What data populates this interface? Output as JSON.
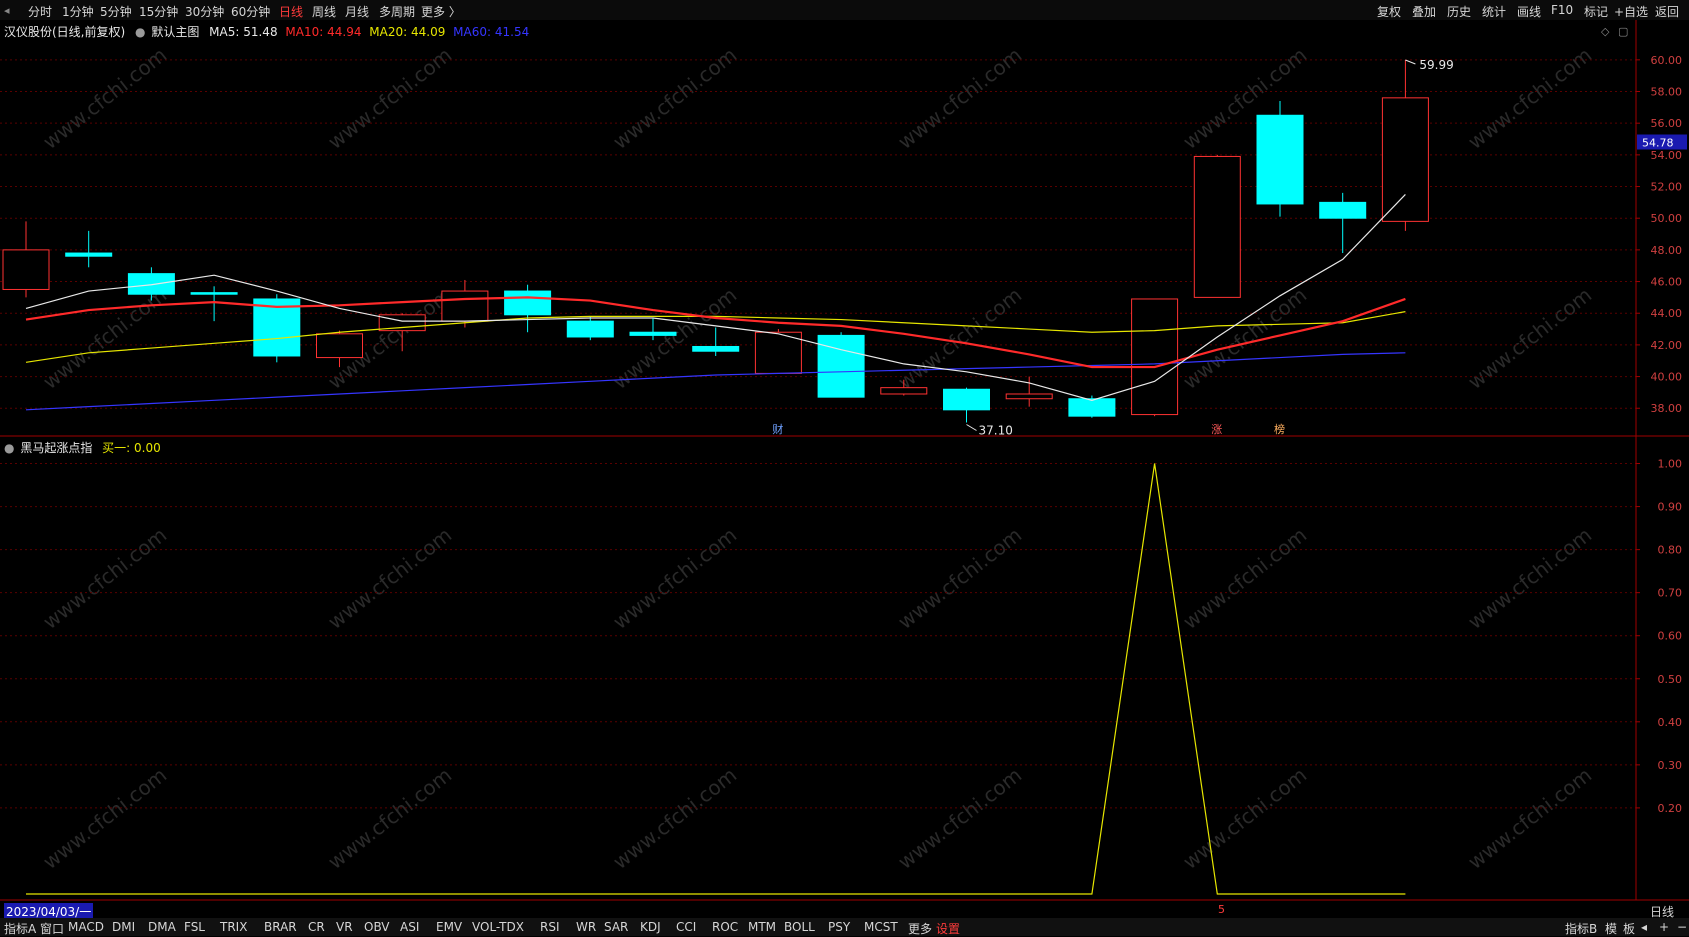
{
  "toolbar": {
    "timeframes": [
      "分时",
      "1分钟",
      "5分钟",
      "15分钟",
      "30分钟",
      "60分钟",
      "日线",
      "周线",
      "月线",
      "多周期",
      "更多 〉"
    ],
    "active_timeframe": "日线",
    "right_items": [
      "复权",
      "叠加",
      "历史",
      "统计",
      "画线",
      "F10",
      "标记",
      "+自选",
      "返回"
    ]
  },
  "main_panel": {
    "title": "汉仪股份(日线,前复权)",
    "indicator_name": "默认主图",
    "ma": [
      {
        "label": "MA5: 51.48",
        "color": "#e8e8e8"
      },
      {
        "label": "MA10: 44.94",
        "color": "#ff2a2a"
      },
      {
        "label": "MA20: 44.09",
        "color": "#e6e600"
      },
      {
        "label": "MA60: 41.54",
        "color": "#3535ff"
      }
    ],
    "price_tag": "54.78",
    "high_label": "59.99",
    "low_label": "37.10",
    "markers": [
      "财",
      "涨",
      "榜"
    ]
  },
  "sub_panel": {
    "title": "黑马起涨点指",
    "value_label": "买一: 0.00"
  },
  "footer": {
    "date": "2023/04/03/一",
    "marker": "5",
    "period": "日线"
  },
  "bottom_tabs": [
    "指标A",
    "窗口",
    "MACD",
    "DMI",
    "DMA",
    "FSL",
    "TRIX",
    "BRAR",
    "CR",
    "VR",
    "OBV",
    "ASI",
    "EMV",
    "VOL-TDX",
    "RSI",
    "WR",
    "SAR",
    "KDJ",
    "CCI",
    "ROC",
    "MTM",
    "BOLL",
    "PSY",
    "MCST",
    "更多",
    "设置"
  ],
  "bottom_right": [
    "指标B",
    "模",
    "板",
    "◂",
    "+",
    "−"
  ],
  "watermark": "www.cfchi.com",
  "chart_data": {
    "type": "candlestick",
    "ylim_main": [
      36.5,
      61.0
    ],
    "ylim_sub": [
      0,
      1.05
    ],
    "y_ticks_main": [
      "60.00",
      "58.00",
      "56.00",
      "54.00",
      "52.00",
      "50.00",
      "48.00",
      "46.00",
      "44.00",
      "42.00",
      "40.00",
      "38.00"
    ],
    "y_ticks_sub": [
      "1.00",
      "0.90",
      "0.80",
      "0.70",
      "0.60",
      "0.50",
      "0.40",
      "0.30",
      "0.20"
    ],
    "candles": [
      {
        "o": 45.5,
        "h": 49.8,
        "l": 45.0,
        "c": 48.0
      },
      {
        "o": 47.8,
        "h": 49.2,
        "l": 46.9,
        "c": 47.6
      },
      {
        "o": 46.5,
        "h": 46.9,
        "l": 44.8,
        "c": 45.2
      },
      {
        "o": 45.3,
        "h": 45.7,
        "l": 43.5,
        "c": 45.2
      },
      {
        "o": 44.9,
        "h": 45.2,
        "l": 40.9,
        "c": 41.3
      },
      {
        "o": 41.2,
        "h": 42.9,
        "l": 40.6,
        "c": 42.7
      },
      {
        "o": 42.9,
        "h": 44.0,
        "l": 41.6,
        "c": 43.9
      },
      {
        "o": 43.5,
        "h": 46.1,
        "l": 43.1,
        "c": 45.4
      },
      {
        "o": 45.4,
        "h": 45.8,
        "l": 42.8,
        "c": 43.9
      },
      {
        "o": 43.5,
        "h": 43.8,
        "l": 42.3,
        "c": 42.5
      },
      {
        "o": 42.8,
        "h": 43.7,
        "l": 42.3,
        "c": 42.6
      },
      {
        "o": 41.9,
        "h": 43.1,
        "l": 41.3,
        "c": 41.6
      },
      {
        "o": 40.2,
        "h": 43.0,
        "l": 40.2,
        "c": 42.8
      },
      {
        "o": 42.6,
        "h": 42.8,
        "l": 38.7,
        "c": 38.7
      },
      {
        "o": 38.9,
        "h": 39.8,
        "l": 38.8,
        "c": 39.3
      },
      {
        "o": 39.2,
        "h": 39.3,
        "l": 37.1,
        "c": 37.9
      },
      {
        "o": 38.6,
        "h": 40.0,
        "l": 38.1,
        "c": 38.9
      },
      {
        "o": 38.6,
        "h": 38.8,
        "l": 37.4,
        "c": 37.5
      },
      {
        "o": 37.6,
        "h": 44.9,
        "l": 37.5,
        "c": 44.9
      },
      {
        "o": 45.0,
        "h": 54.0,
        "l": 45.0,
        "c": 53.9
      },
      {
        "o": 56.5,
        "h": 57.4,
        "l": 50.1,
        "c": 50.9
      },
      {
        "o": 51.0,
        "h": 51.6,
        "l": 47.8,
        "c": 50.0
      },
      {
        "o": 49.8,
        "h": 59.99,
        "l": 49.2,
        "c": 57.6
      }
    ],
    "ma5": [
      44.3,
      45.4,
      45.8,
      46.4,
      45.4,
      44.3,
      43.5,
      43.5,
      43.6,
      43.7,
      43.7,
      43.2,
      42.7,
      41.7,
      40.8,
      40.3,
      39.6,
      38.5,
      39.7,
      42.5,
      45.1,
      47.4,
      51.5
    ],
    "ma10": [
      43.6,
      44.2,
      44.5,
      44.7,
      44.4,
      44.5,
      44.7,
      44.9,
      45.0,
      44.8,
      44.2,
      43.7,
      43.4,
      43.2,
      42.7,
      42.1,
      41.4,
      40.6,
      40.6,
      41.7,
      42.6,
      43.5,
      44.9
    ],
    "ma20": [
      40.9,
      41.5,
      41.8,
      42.1,
      42.4,
      42.8,
      43.1,
      43.4,
      43.7,
      43.8,
      43.8,
      43.8,
      43.7,
      43.6,
      43.4,
      43.2,
      43.0,
      42.8,
      42.9,
      43.2,
      43.3,
      43.4,
      44.1
    ],
    "ma60": [
      37.9,
      38.1,
      38.3,
      38.5,
      38.7,
      38.9,
      39.1,
      39.3,
      39.5,
      39.7,
      39.9,
      40.1,
      40.2,
      40.3,
      40.4,
      40.5,
      40.6,
      40.7,
      40.8,
      41.0,
      41.2,
      41.4,
      41.5
    ],
    "signal": [
      0,
      0,
      0,
      0,
      0,
      0,
      0,
      0,
      0,
      0,
      0,
      0,
      0,
      0,
      0,
      0,
      0,
      0,
      1.0,
      0,
      0,
      0,
      0
    ]
  }
}
